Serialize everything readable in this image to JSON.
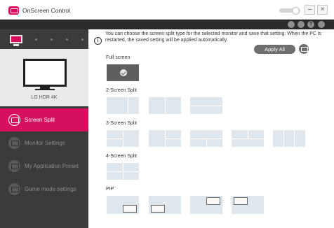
{
  "window": {
    "title": "OnScreen Control",
    "minimize_glyph": "–",
    "close_glyph": "×"
  },
  "toolbar": {
    "icons": [
      "refresh-icon",
      "display-icon",
      "help-icon",
      "gear-icon"
    ],
    "help_glyph": "?"
  },
  "monitor": {
    "name": "LG HDR 4K"
  },
  "sidebar": {
    "items": [
      {
        "label": "Screen Split",
        "icon": "split-screen-icon",
        "active": true
      },
      {
        "label": "Monitor Settings",
        "icon": "monitor-settings-icon",
        "active": false
      },
      {
        "label": "My Application Preset",
        "icon": "app-preset-icon",
        "active": false
      },
      {
        "label": "Game mode settings",
        "icon": "gamepad-icon",
        "active": false
      }
    ]
  },
  "main": {
    "info_glyph": "i",
    "info_text": "You can choose the screen split type for the selected monitor and save that setting. When the PC is restarted, the saved setting will be applied automatically.",
    "apply_all_label": "Apply All",
    "sections": {
      "full": "Full screen",
      "two": "2-Screen Split",
      "three": "3-Screen Split",
      "four": "4-Screen Split",
      "pip": "PIP"
    }
  },
  "colors": {
    "accent": "#d6105e",
    "sidebar": "#3b3b3b",
    "thumbnail": "#dfe6ec",
    "selected_thumbnail": "#5f5f5f"
  }
}
